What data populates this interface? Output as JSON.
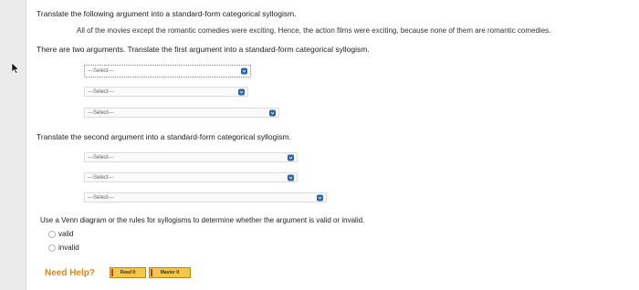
{
  "question": {
    "instruction": "Translate the following argument into a standard-form categorical syllogism.",
    "argument": "All of the movies except the romantic comedies were exciting. Hence, the action films were exciting, because none of them are romantic comedies.",
    "two_arguments_note": "There are two arguments. Translate the first argument into a standard-form categorical syllogism.",
    "second_instruction": "Translate the second argument into a standard-form categorical syllogism.",
    "venn_instruction": "Use a Venn diagram or the rules for syllogisms to determine whether the argument is valid or invalid."
  },
  "first_argument": {
    "selects": [
      {
        "value": "---Select---",
        "focused": true
      },
      {
        "value": "---Select---",
        "focused": false
      },
      {
        "value": "---Select---",
        "focused": false
      }
    ]
  },
  "second_argument": {
    "selects": [
      {
        "value": "---Select---",
        "focused": false
      },
      {
        "value": "---Select---",
        "focused": false
      },
      {
        "value": "---Select---",
        "focused": false
      }
    ]
  },
  "validity_options": [
    "valid",
    "invalid"
  ],
  "help": {
    "label": "Need Help?",
    "read_it": "Read It",
    "master_it": "Master It"
  },
  "colors": {
    "accent": "#2a62b4",
    "help_orange": "#d98a1a",
    "button_yellow": "#f3c84a"
  }
}
